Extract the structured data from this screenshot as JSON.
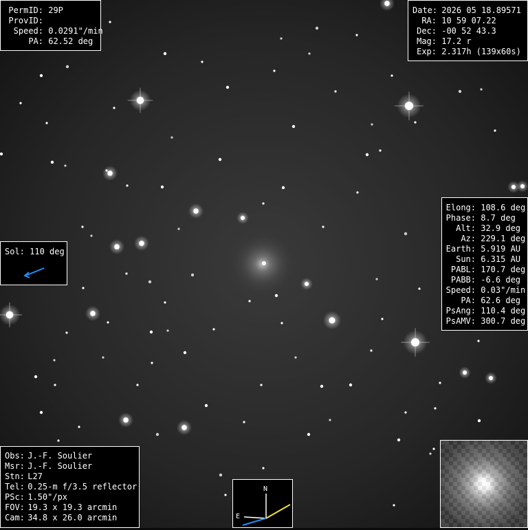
{
  "object_info": {
    "permid_label": "PermID:",
    "permid_value": "29P",
    "provid_label": "ProvID:",
    "provid_value": "",
    "speed_label": "Speed:",
    "speed_value": "0.0291\"/min",
    "pa_label": "PA:",
    "pa_value": "62.52 deg"
  },
  "observation": {
    "date_label": "Date:",
    "date_value": "2026 05 18.89571",
    "ra_label": "RA:",
    "ra_value": "10 59 07.22",
    "dec_label": "Dec:",
    "dec_value": "-00 52 43.3",
    "mag_label": "Mag:",
    "mag_value": "17.2 r",
    "exp_label": "Exp:",
    "exp_value": "2.317h (139x60s)"
  },
  "sol": {
    "label": "Sol:",
    "value": "110 deg",
    "arrow_color": "#1e90ff"
  },
  "geometry": [
    {
      "label": "Elong:",
      "value": "108.6 deg"
    },
    {
      "label": "Phase:",
      "value": "8.7 deg"
    },
    {
      "label": "Alt:",
      "value": "32.9 deg"
    },
    {
      "label": "Az:",
      "value": "229.1 deg"
    },
    {
      "label": "Earth:",
      "value": "5.919 AU"
    },
    {
      "label": "Sun:",
      "value": "6.315 AU"
    },
    {
      "label": "PABL:",
      "value": "170.7 deg"
    },
    {
      "label": "PABB:",
      "value": "-6.6 deg"
    },
    {
      "label": "Speed:",
      "value": "0.03\"/min"
    },
    {
      "label": "PA:",
      "value": "62.6 deg"
    },
    {
      "label": "PsAng:",
      "value": "110.4 deg"
    },
    {
      "label": "PsAMV:",
      "value": "300.7 deg"
    }
  ],
  "station": [
    {
      "label": "Obs:",
      "value": "J.-F. Soulier"
    },
    {
      "label": "Msr:",
      "value": "J.-F. Soulier"
    },
    {
      "label": "Stn:",
      "value": "L27"
    },
    {
      "label": "Tel:",
      "value": "0.25-m f/3.5 reflector"
    },
    {
      "label": "PSc:",
      "value": "1.50\"/px"
    },
    {
      "label": "FOV:",
      "value": "19.3 x 19.3 arcmin"
    },
    {
      "label": "Cam:",
      "value": "34.8 x 26.0 arcmin"
    }
  ],
  "compass": {
    "north_label": "N",
    "east_label": "E",
    "motion_color": "#f0e040",
    "sun_color": "#1e90ff"
  },
  "colors": {
    "sky": "#0b0b0b",
    "panel": "#000000",
    "text": "#ffffff"
  }
}
